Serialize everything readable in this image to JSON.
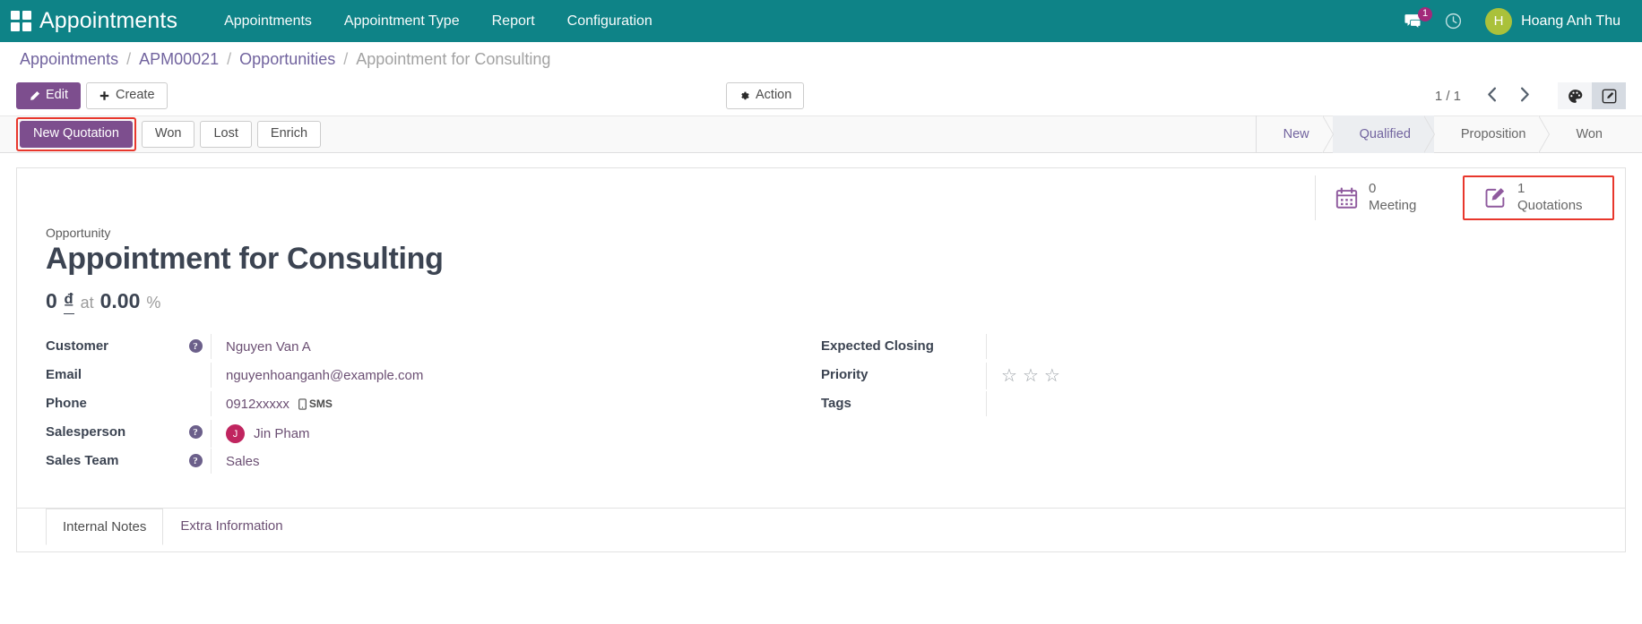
{
  "navbar": {
    "apps_icon": "apps-grid-icon",
    "brand": "Appointments",
    "menu": [
      {
        "label": "Appointments"
      },
      {
        "label": "Appointment Type"
      },
      {
        "label": "Report"
      },
      {
        "label": "Configuration"
      }
    ],
    "messages_icon": "messages-icon",
    "messages_count": "1",
    "activities_icon": "clock-icon",
    "user": {
      "initial": "H",
      "name": "Hoang Anh Thu",
      "avatar_color": "#aac13a"
    }
  },
  "breadcrumb": {
    "items": [
      {
        "label": "Appointments",
        "active": false
      },
      {
        "label": "APM00021",
        "active": false
      },
      {
        "label": "Opportunities",
        "active": false
      },
      {
        "label": "Appointment for Consulting",
        "active": true
      }
    ],
    "separator": "/"
  },
  "control_panel": {
    "edit_label": "Edit",
    "edit_icon": "pencil-icon",
    "create_label": "Create",
    "create_icon": "plus-icon",
    "action_label": "Action",
    "action_icon": "gear-icon",
    "pager_value": "1 / 1",
    "prev_icon": "chevron-left-icon",
    "next_icon": "chevron-right-icon",
    "view_kanban_icon": "kanban-palette-icon",
    "view_form_icon": "form-edit-icon",
    "active_view": "form"
  },
  "statusbar": {
    "buttons": [
      {
        "label": "New Quotation",
        "style": "primary",
        "highlighted": true
      },
      {
        "label": "Won",
        "style": "default",
        "highlighted": false
      },
      {
        "label": "Lost",
        "style": "default",
        "highlighted": false
      },
      {
        "label": "Enrich",
        "style": "default",
        "highlighted": false
      }
    ],
    "stages": [
      {
        "label": "New",
        "state": "done"
      },
      {
        "label": "Qualified",
        "state": "current"
      },
      {
        "label": "Proposition",
        "state": "upcoming"
      },
      {
        "label": "Won",
        "state": "upcoming"
      }
    ]
  },
  "smart_buttons": [
    {
      "icon": "calendar-icon",
      "value": "0",
      "label": "Meeting",
      "highlighted": false
    },
    {
      "icon": "quotation-edit-icon",
      "value": "1",
      "label": "Quotations",
      "highlighted": true
    }
  ],
  "record": {
    "subtitle": "Opportunity",
    "title": "Appointment for Consulting",
    "revenue": "0",
    "currency": "₫",
    "at_label": "at",
    "probability": "0.00",
    "percent_symbol": "%"
  },
  "fields_left": [
    {
      "label": "Customer",
      "help": true,
      "value": "Nguyen Van A",
      "type": "link"
    },
    {
      "label": "Email",
      "help": false,
      "value": "nguyenhoanganh@example.com",
      "type": "link"
    },
    {
      "label": "Phone",
      "help": false,
      "value": "0912xxxxx",
      "type": "phone",
      "sms_label": "SMS",
      "sms_icon": "mobile-icon"
    },
    {
      "label": "Salesperson",
      "help": true,
      "value": "Jin Pham",
      "type": "user",
      "avatar_initial": "J",
      "avatar_color": "#c0255f"
    },
    {
      "label": "Sales Team",
      "help": true,
      "value": "Sales",
      "type": "link"
    }
  ],
  "fields_right": [
    {
      "label": "Expected Closing",
      "value": "",
      "type": "text"
    },
    {
      "label": "Priority",
      "value": "",
      "type": "stars",
      "star_count": 3,
      "stars_filled": 0,
      "star_icon": "star-outline-icon"
    },
    {
      "label": "Tags",
      "value": "",
      "type": "text"
    }
  ],
  "notebook": {
    "tabs": [
      {
        "label": "Internal Notes",
        "active": true
      },
      {
        "label": "Extra Information",
        "active": false
      }
    ]
  },
  "colors": {
    "brand_teal": "#0e8387",
    "purple": "#7d4e8e",
    "link_purple": "#71639e",
    "highlight_red": "#e8372c",
    "avatar_green": "#aac13a"
  }
}
